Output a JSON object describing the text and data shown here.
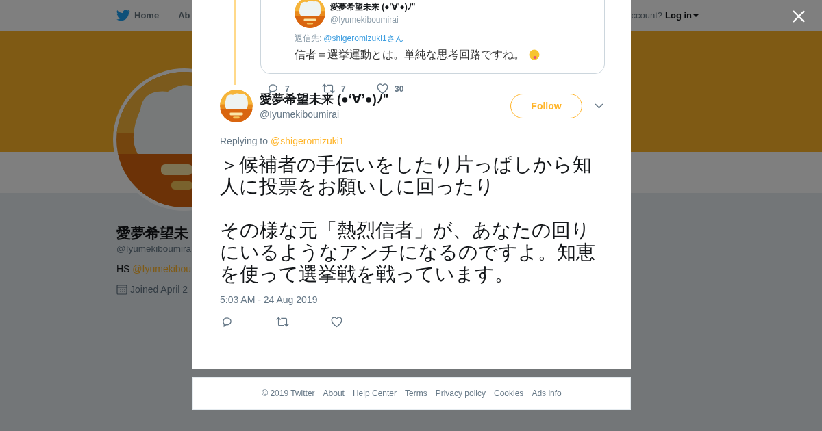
{
  "nav": {
    "items": [
      {
        "label": "Home"
      },
      {
        "label": "Ab"
      }
    ],
    "login_prompt": "ccount?",
    "login": "Log in"
  },
  "profile": {
    "name": "愛夢希望未",
    "handle": "@Iyumekiboumira",
    "bio_prefix": "HS",
    "bio_link": "@Iyumekibou",
    "joined": "Joined April 2"
  },
  "modal": {
    "quoted_image": {
      "name": "愛夢希望未来 (●'∀'●)ﾉ\"",
      "handle": "@Iyumekiboumirai",
      "reply_label": "返信先:",
      "reply_to": "@shigeromizuki1さん",
      "text": "信者＝選挙運動とは。単純な思考回路ですね。"
    },
    "previous_actions": [
      {
        "kind": "reply",
        "count": "7"
      },
      {
        "kind": "retweet",
        "count": "7"
      },
      {
        "kind": "like",
        "count": "30"
      }
    ],
    "tweet": {
      "name": "愛夢希望未来 (●‘∀’●)ﾉ\"",
      "handle": "@Iyumekiboumirai",
      "follow": "Follow",
      "replying_label": "Replying to",
      "replying_to": "@shigeromizuki1",
      "paragraphs": [
        "＞候補者の手伝いをしたり片っぱしから知人に投票をお願いしに回ったり",
        "その様な元「熱烈信者」が、あなたの回りにいるようなアンチになるのですよ。知恵を使って選挙戦を戦っています。"
      ],
      "time": "5:03 AM - 24 Aug 2019",
      "actions": [
        {
          "kind": "reply"
        },
        {
          "kind": "retweet"
        },
        {
          "kind": "like"
        }
      ]
    }
  },
  "footer": [
    "© 2019 Twitter",
    "About",
    "Help Center",
    "Terms",
    "Privacy policy",
    "Cookies",
    "Ads info"
  ]
}
